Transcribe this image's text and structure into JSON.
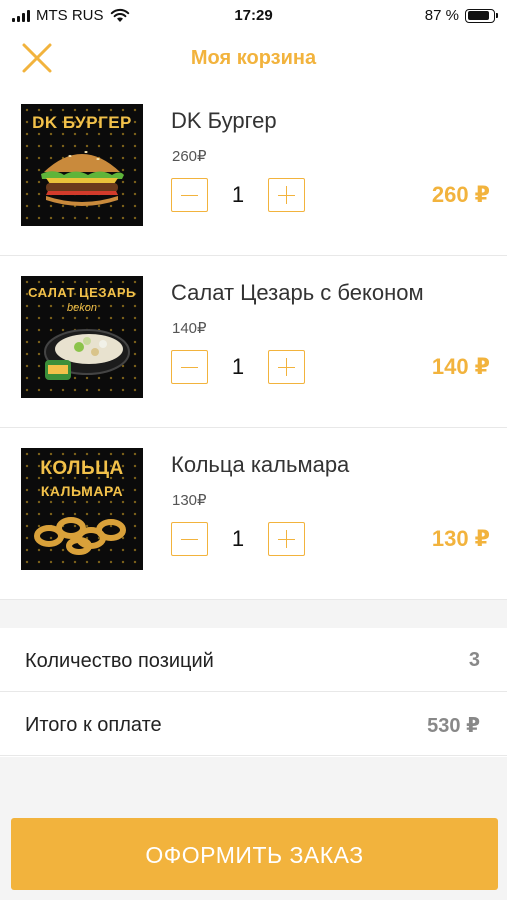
{
  "status_bar": {
    "carrier": "MTS RUS",
    "time": "17:29",
    "battery_pct": "87 %",
    "battery_level": 0.87
  },
  "header": {
    "title": "Моя корзина",
    "close_icon": "close-icon"
  },
  "accent_color": "#f2b33d",
  "cart": {
    "items": [
      {
        "name": "DK Бургер",
        "unit_price": "260₽",
        "quantity": "1",
        "total": "260 ₽",
        "image_label": "DK БУРГЕР"
      },
      {
        "name": "Салат Цезарь с беконом",
        "unit_price": "140₽",
        "quantity": "1",
        "total": "140 ₽",
        "image_label": "САЛАТ ЦЕЗАРЬ",
        "image_sublabel": "bekon"
      },
      {
        "name": "Кольца кальмара",
        "unit_price": "130₽",
        "quantity": "1",
        "total": "130 ₽",
        "image_label": "КОЛЬЦА",
        "image_label2": "КАЛЬМАРА"
      }
    ]
  },
  "summary": {
    "positions_label": "Количество позиций",
    "positions_value": "3",
    "total_label": "Итого к оплате",
    "total_value": "530 ₽"
  },
  "checkout": {
    "label": "ОФОРМИТЬ ЗАКАЗ"
  }
}
